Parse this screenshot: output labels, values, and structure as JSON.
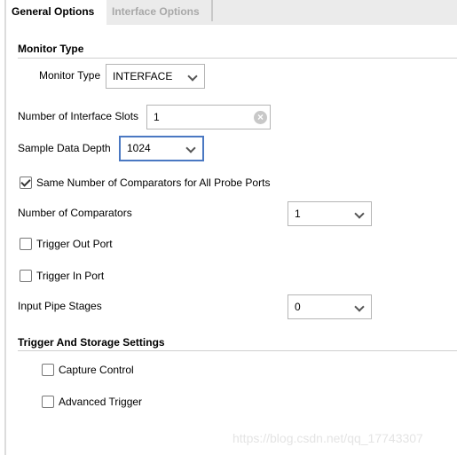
{
  "tabs": [
    {
      "label": "General Options",
      "active": true
    },
    {
      "label": "Interface Options",
      "active": false
    }
  ],
  "monitor_section": {
    "title": "Monitor Type",
    "monitor_type_label": "Monitor Type",
    "monitor_type_value": "INTERFACE"
  },
  "slots": {
    "label": "Number of Interface Slots",
    "value": "1"
  },
  "depth": {
    "label": "Sample Data Depth",
    "value": "1024"
  },
  "same_comparators": {
    "label": "Same Number of Comparators for All Probe Ports",
    "checked": true
  },
  "comparators": {
    "label": "Number of Comparators",
    "value": "1"
  },
  "trigger_out": {
    "label": "Trigger Out Port",
    "checked": false
  },
  "trigger_in": {
    "label": "Trigger In Port",
    "checked": false
  },
  "pipe_stages": {
    "label": "Input Pipe Stages",
    "value": "0"
  },
  "trigger_section": {
    "title": "Trigger And Storage Settings"
  },
  "capture_control": {
    "label": "Capture Control",
    "checked": false
  },
  "advanced_trigger": {
    "label": "Advanced Trigger",
    "checked": false
  },
  "watermark": "https://blog.csdn.net/qq_17743307",
  "colors": {
    "focus": "#4a78c2",
    "tabbar": "#ebebeb"
  }
}
